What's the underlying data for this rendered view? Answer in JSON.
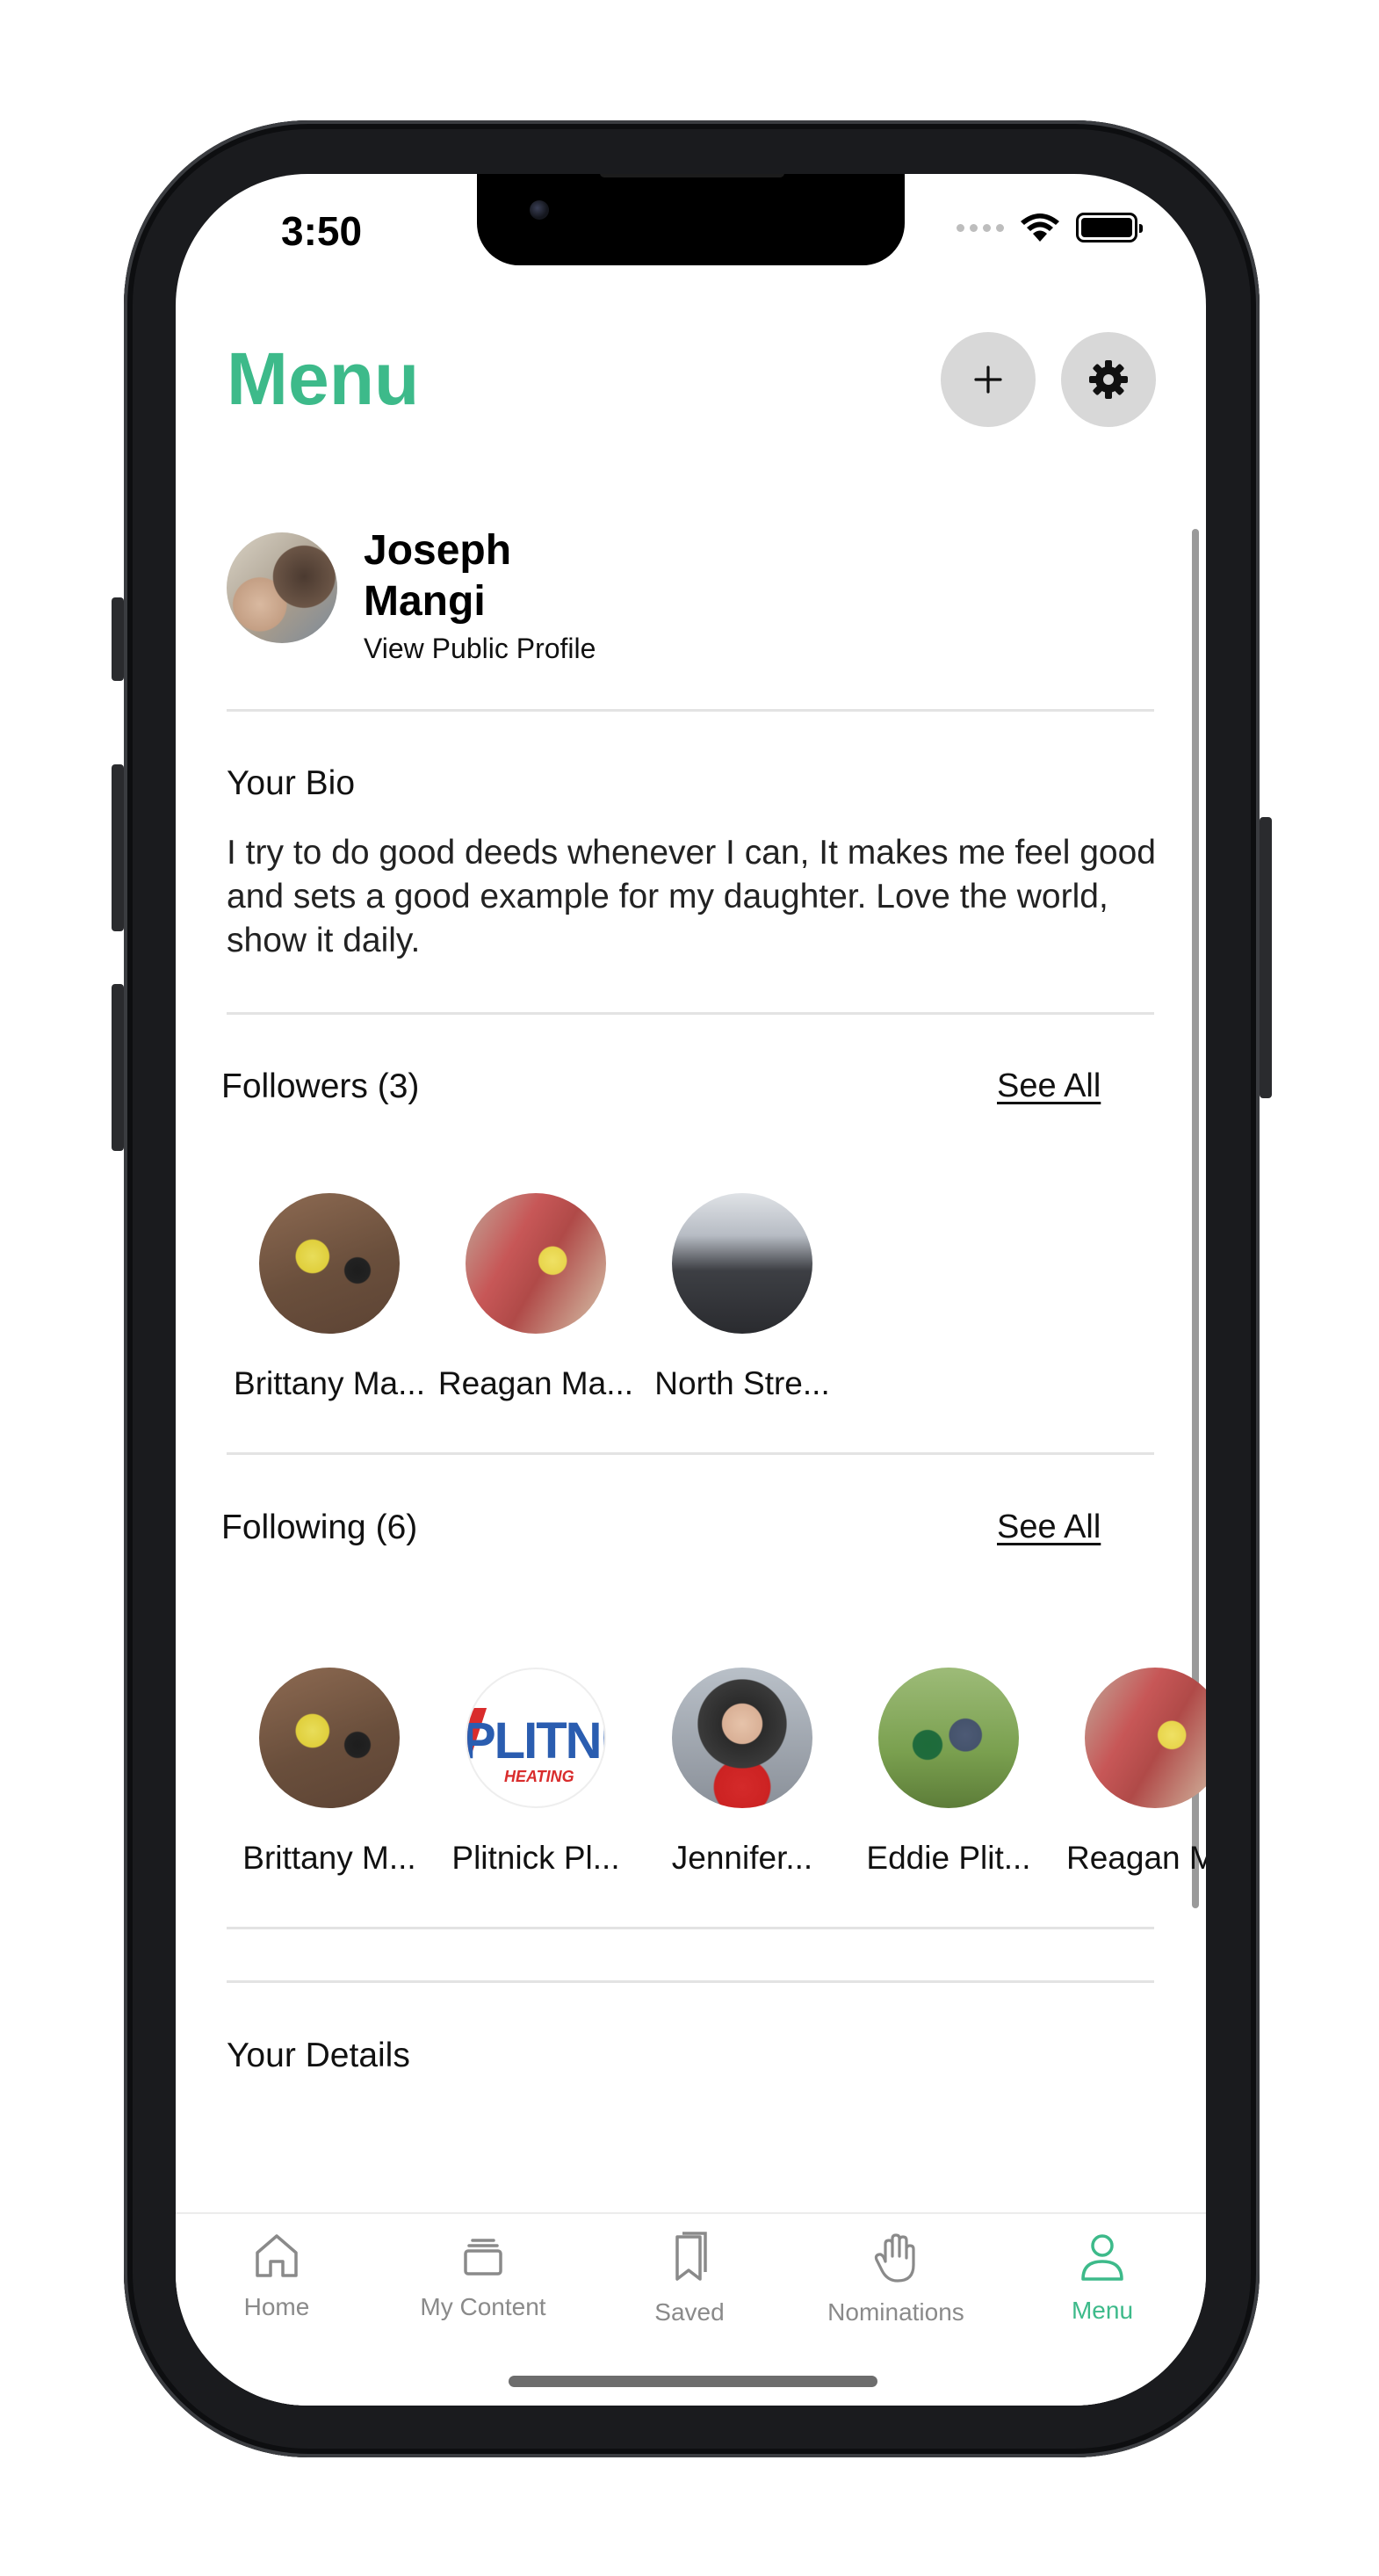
{
  "status_bar": {
    "time": "3:50"
  },
  "header": {
    "title": "Menu",
    "add_button_icon": "plus-icon",
    "settings_button_icon": "gear-icon"
  },
  "profile": {
    "name_first": "Joseph",
    "name_last": "Mangi",
    "link_label": "View Public Profile"
  },
  "bio": {
    "heading": "Your Bio",
    "text": "I try to do good deeds whenever I can, It makes me feel good and sets a good example for my daughter. Love the world, show it daily."
  },
  "followers": {
    "heading": "Followers (3)",
    "see_all": "See All",
    "people": [
      {
        "name": "Brittany Ma..."
      },
      {
        "name": "Reagan Ma..."
      },
      {
        "name": "North Stre..."
      }
    ]
  },
  "following": {
    "heading": "Following (6)",
    "see_all": "See All",
    "people": [
      {
        "name": "Brittany M..."
      },
      {
        "name": "Plitnick Pl..."
      },
      {
        "name": "Jennifer..."
      },
      {
        "name": "Eddie  Plit..."
      },
      {
        "name": "Reagan M"
      }
    ]
  },
  "logo_text": {
    "main": "PLITNI",
    "sub": "HEATING"
  },
  "details": {
    "heading": "Your Details",
    "cards": [
      {
        "icon": "image-icon"
      },
      {
        "icon": "document-icon"
      }
    ]
  },
  "tabbar": {
    "active": "Menu",
    "tabs": [
      {
        "label": "Home",
        "icon": "home-icon"
      },
      {
        "label": "My Content",
        "icon": "stack-icon"
      },
      {
        "label": "Saved",
        "icon": "bookmarks-icon"
      },
      {
        "label": "Nominations",
        "icon": "hand-icon"
      },
      {
        "label": "Menu",
        "icon": "person-icon"
      }
    ]
  },
  "colors": {
    "accent": "#3dba8a",
    "button_bg": "#d8d8d8",
    "tab_inactive": "#8a8a8a",
    "card_bg": "#f5f6fb"
  }
}
